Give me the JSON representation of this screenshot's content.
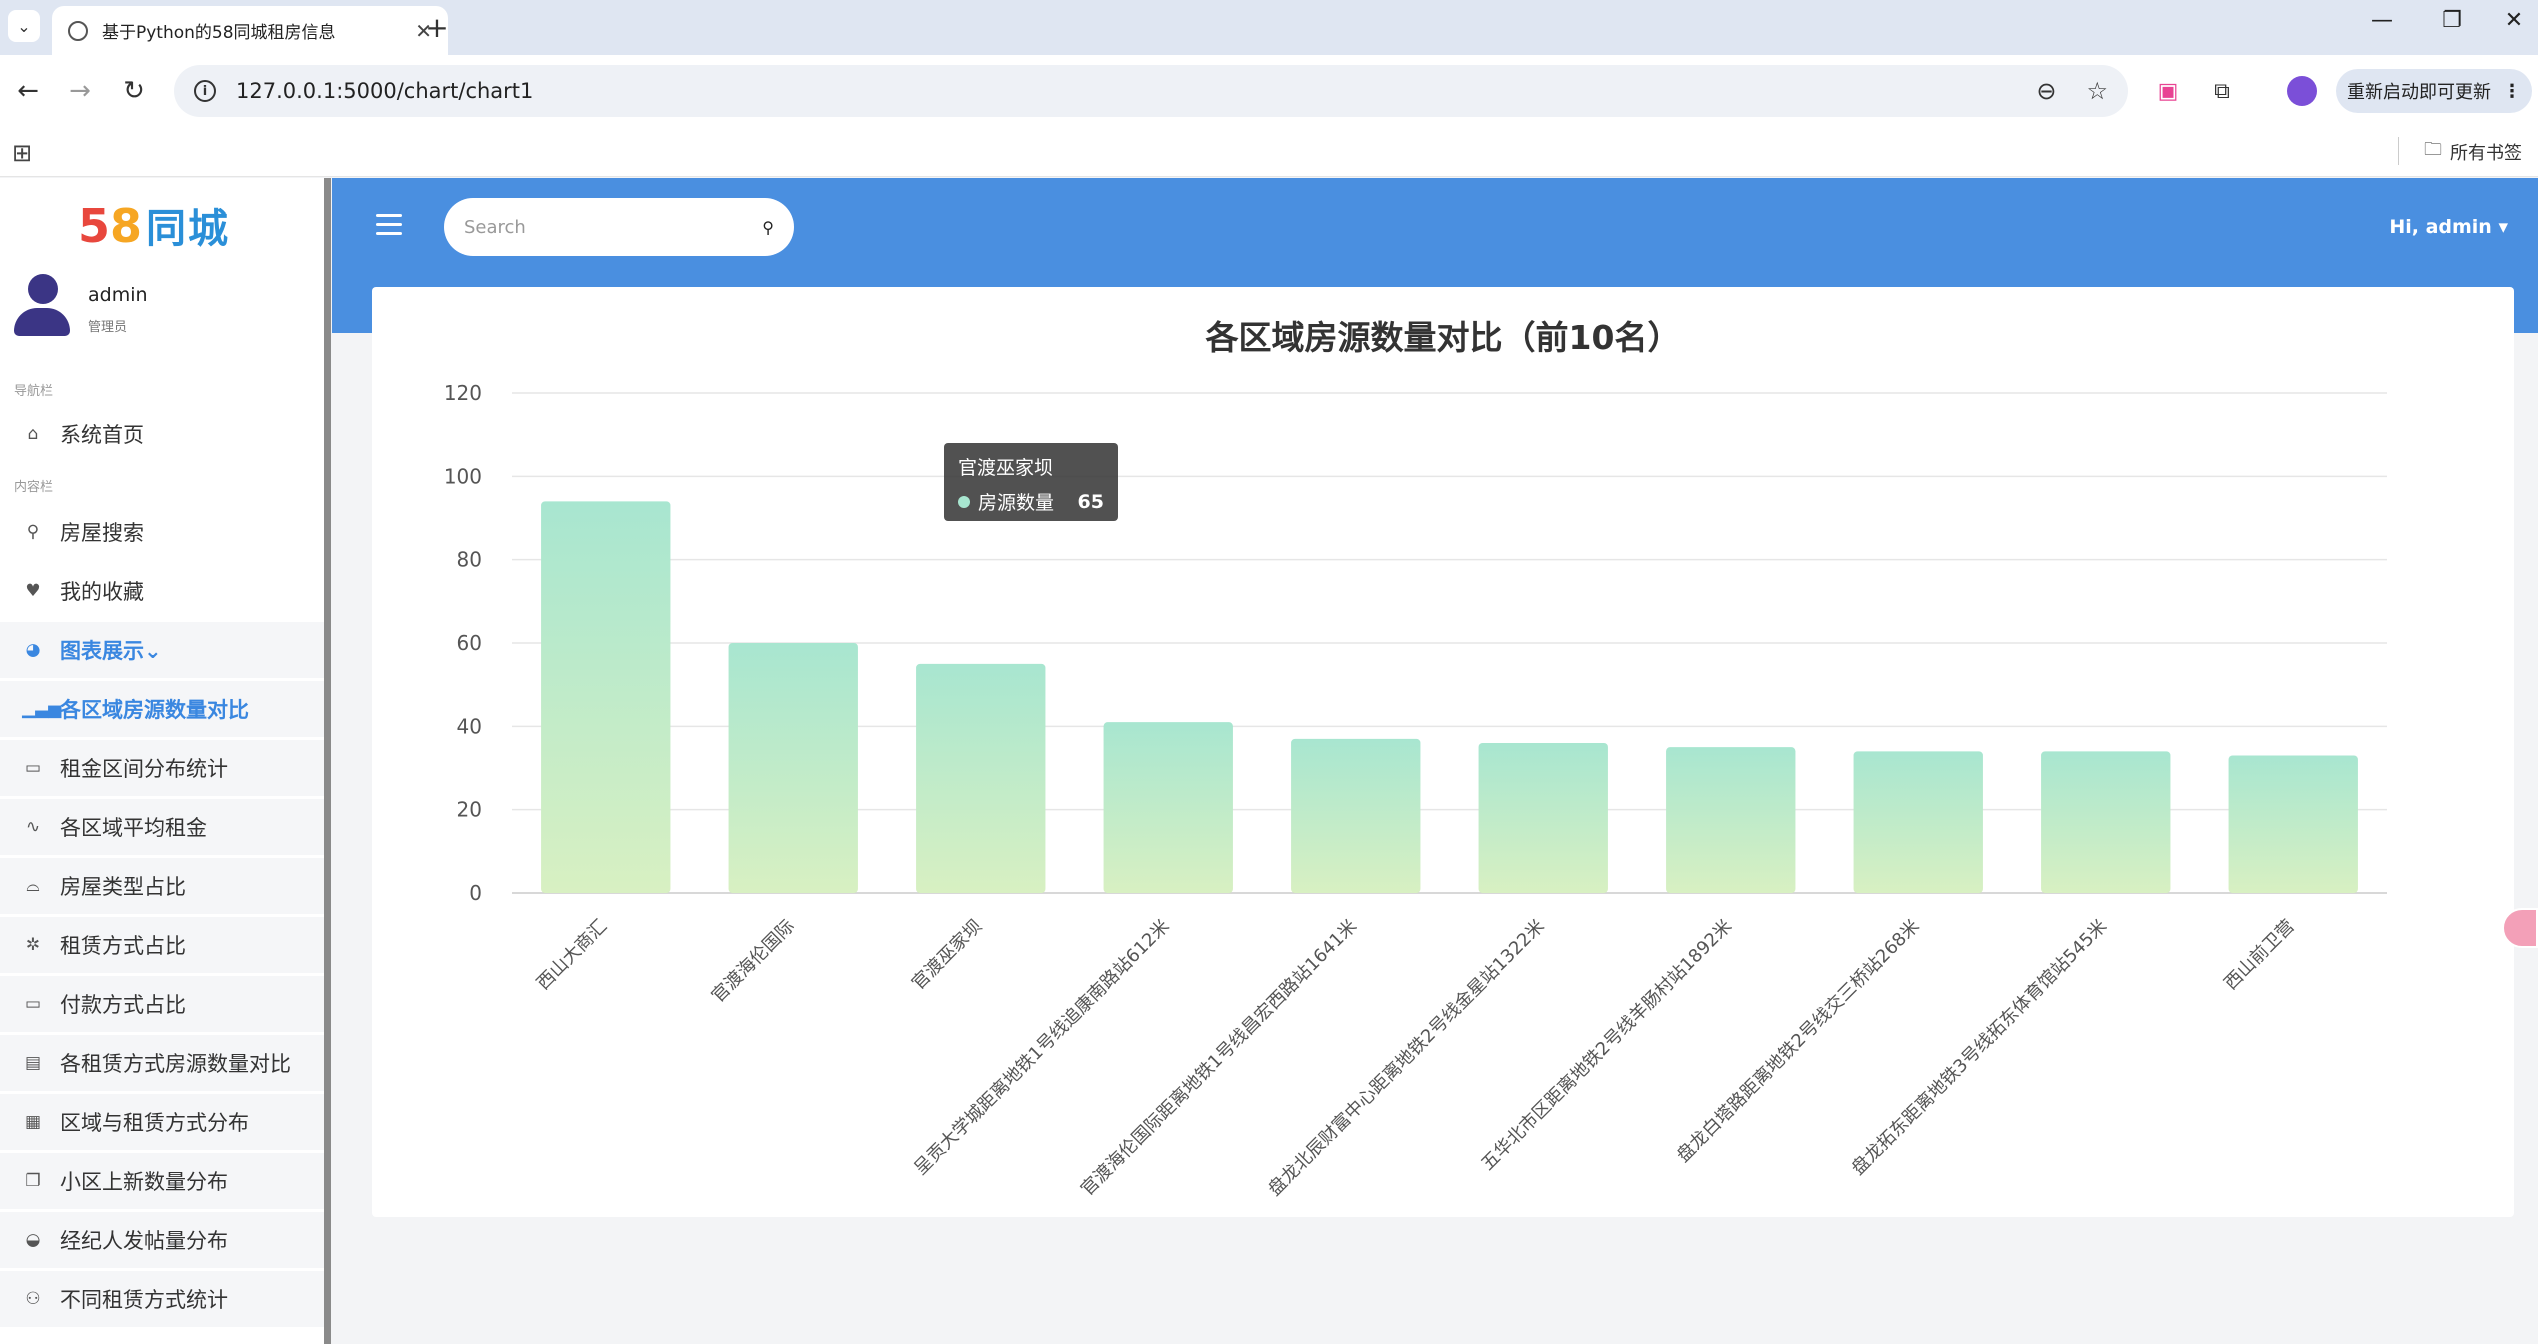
{
  "browser": {
    "tab_title": "基于Python的58同城租房信息",
    "url": "127.0.0.1:5000/chart/chart1",
    "update_label": "重新启动即可更新",
    "bookmarks_all": "所有书签"
  },
  "sidebar": {
    "logo_5": "5",
    "logo_8": "8",
    "logo_text": "同城",
    "user_name": "admin",
    "user_role": "管理员",
    "nav_label": "导航栏",
    "content_label": "内容栏",
    "items": [
      {
        "label": "系统首页",
        "icon": "home-icon"
      },
      {
        "label": "房屋搜索",
        "icon": "search-icon"
      },
      {
        "label": "我的收藏",
        "icon": "heart-icon"
      },
      {
        "label": "图表展示⌄",
        "icon": "pie-chart-icon"
      },
      {
        "label": "各区域房源数量对比",
        "icon": "bar-chart-icon"
      },
      {
        "label": "租金区间分布统计",
        "icon": "keyboard-icon"
      },
      {
        "label": "各区域平均租金",
        "icon": "pulse-icon"
      },
      {
        "label": "房屋类型占比",
        "icon": "building-icon"
      },
      {
        "label": "租赁方式占比",
        "icon": "snowflake-icon"
      },
      {
        "label": "付款方式占比",
        "icon": "keyboard-icon"
      },
      {
        "label": "各租赁方式房源数量对比",
        "icon": "book-icon"
      },
      {
        "label": "区域与租赁方式分布",
        "icon": "table-icon"
      },
      {
        "label": "小区上新数量分布",
        "icon": "comments-icon"
      },
      {
        "label": "经纪人发帖量分布",
        "icon": "gauge-icon"
      },
      {
        "label": "不同租赁方式统计",
        "icon": "users-icon"
      }
    ]
  },
  "header": {
    "search_placeholder": "Search",
    "user_greeting": "Hi, admin ▾"
  },
  "tooltip": {
    "title": "官渡巫家坝",
    "series": "房源数量",
    "value": "65"
  },
  "colors": {
    "header_blue": "#4a8fe0",
    "active_blue": "#3a87e0",
    "bar_top": "#a8e6d0",
    "bar_bottom": "#d8f0c2"
  },
  "chart_data": {
    "type": "bar",
    "title": "各区域房源数量对比（前10名）",
    "categories": [
      "西山大商汇",
      "官渡海伦国际",
      "官渡巫家坝",
      "呈贡大学城距离地铁1号线追康南路站612米",
      "官渡海伦国际距离地铁1号线昌宏西路站1641米",
      "盘龙北辰财富中心距离地铁2号线金星站1322米",
      "五华北市区距离地铁2号线羊肠村站1892米",
      "盘龙白塔路距离地铁2号线交三桥站268米",
      "盘龙拓东距离地铁3号线拓东体育馆站545米",
      "西山前卫营"
    ],
    "values": [
      94,
      60,
      55,
      41,
      37,
      36,
      35,
      34,
      34,
      33
    ],
    "ylim": [
      0,
      120
    ],
    "yticks": [
      0,
      20,
      40,
      60,
      80,
      100,
      120
    ],
    "grid": true
  }
}
